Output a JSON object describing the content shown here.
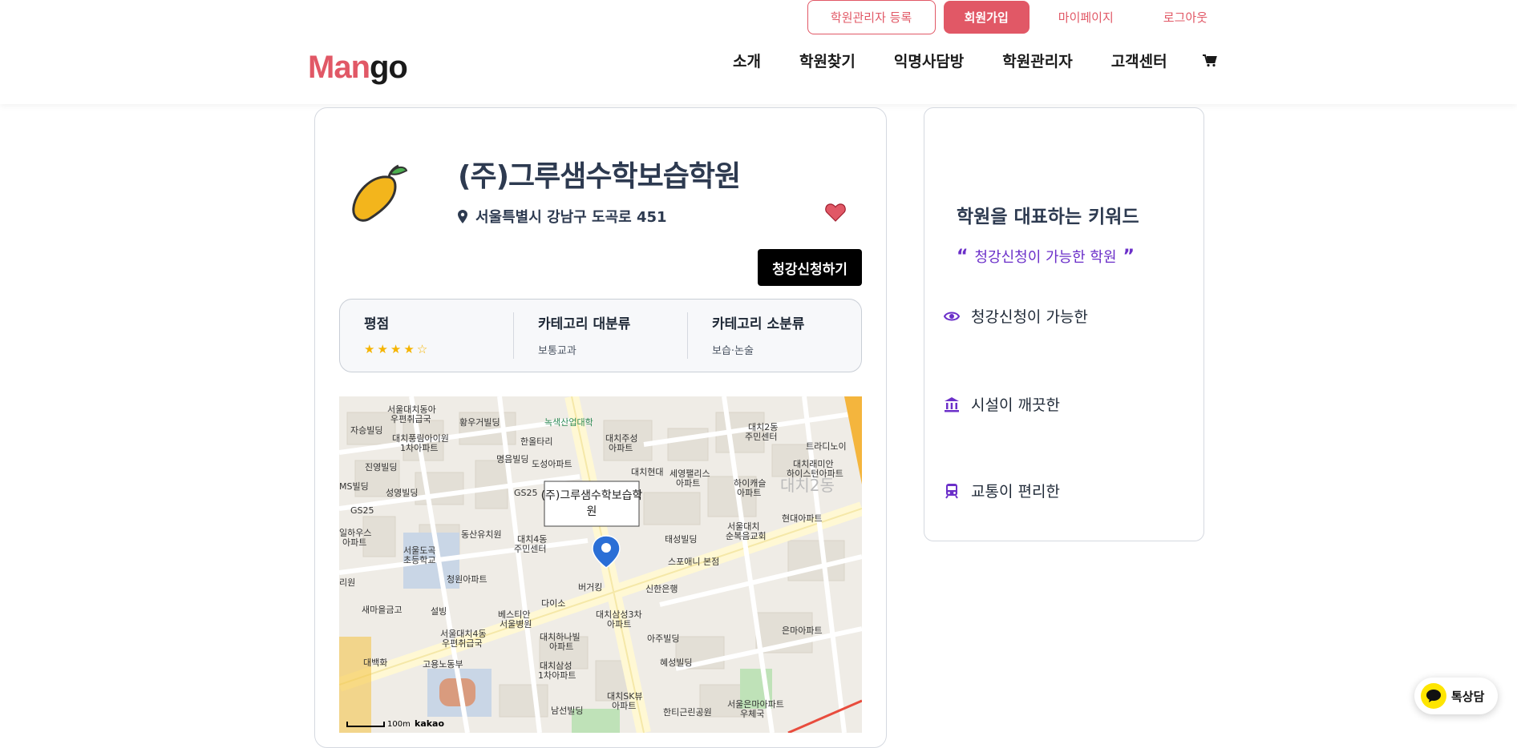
{
  "header": {
    "util_links": {
      "register": "학원관리자 등록",
      "join": "회원가입",
      "mypage": "마이페이지",
      "logout": "로그아웃"
    },
    "logo": {
      "part1": "Man",
      "part2": "go"
    },
    "nav": [
      "소개",
      "학원찾기",
      "익명사담방",
      "학원관리자",
      "고객센터"
    ],
    "cart_icon": "cart-icon"
  },
  "academy": {
    "name": "(주)그루샘수학보습학원",
    "address": "서울특별시 강남구 도곡로 451",
    "apply_label": "청강신청하기",
    "rating_label": "평점",
    "rating": 4,
    "rating_max": 5,
    "category_major_label": "카테고리 대분류",
    "category_major": "보통교과",
    "category_minor_label": "카테고리 소분류",
    "category_minor": "보습·논술"
  },
  "map": {
    "marker_label": "(주)그루샘수학보습학원",
    "scale": "100m",
    "provider": "kakao",
    "labels": [
      "서울대치동아우편취급국",
      "황우거빌딩",
      "녹색산업대학",
      "대치2동 주민센터",
      "자승빌딩",
      "대치풍림아이원 1차아파트",
      "한올타리",
      "대치주성아파트",
      "트라디노이",
      "진영빌딩",
      "명음빌딩",
      "도성아파트",
      "대치현대아파트",
      "세영팰리스아파트",
      "하이캐슬아파트",
      "대치래미안 하이스턴아파트",
      "성영빌딩",
      "GS25",
      "대치4동 주민센터",
      "서울대치 순복음교회",
      "현대아파트",
      "서울도곡 초등학교",
      "동산유치원",
      "태성빌딩",
      "스포애니 본점",
      "청원아파트",
      "버거킹",
      "신한은행",
      "새마을금고",
      "설빙",
      "다이소",
      "베스티안 서울병원",
      "대치삼성3차 아파트",
      "서울대치4동 우편취급국",
      "대치하나빌 아파트",
      "아주빌딩",
      "은마아파트",
      "고용노동부",
      "혜성빌딩",
      "대치삼성 1차아파트",
      "대치SK뷰 아파트",
      "남선빌딩",
      "한티근린공원",
      "서울은마아파트 우체국"
    ]
  },
  "sidebar": {
    "title": "학원을 대표하는 키워드",
    "quote": "청강신청이 가능한 학원",
    "keywords": [
      {
        "icon": "eye-icon",
        "label": "청강신청이 가능한"
      },
      {
        "icon": "building-icon",
        "label": "시설이 깨끗한"
      },
      {
        "icon": "subway-icon",
        "label": "교통이 편리한"
      }
    ]
  },
  "chat": {
    "label": "톡상담"
  },
  "colors": {
    "accent": "#e15866",
    "purple": "#6b2fc9",
    "star": "#f5b400"
  }
}
